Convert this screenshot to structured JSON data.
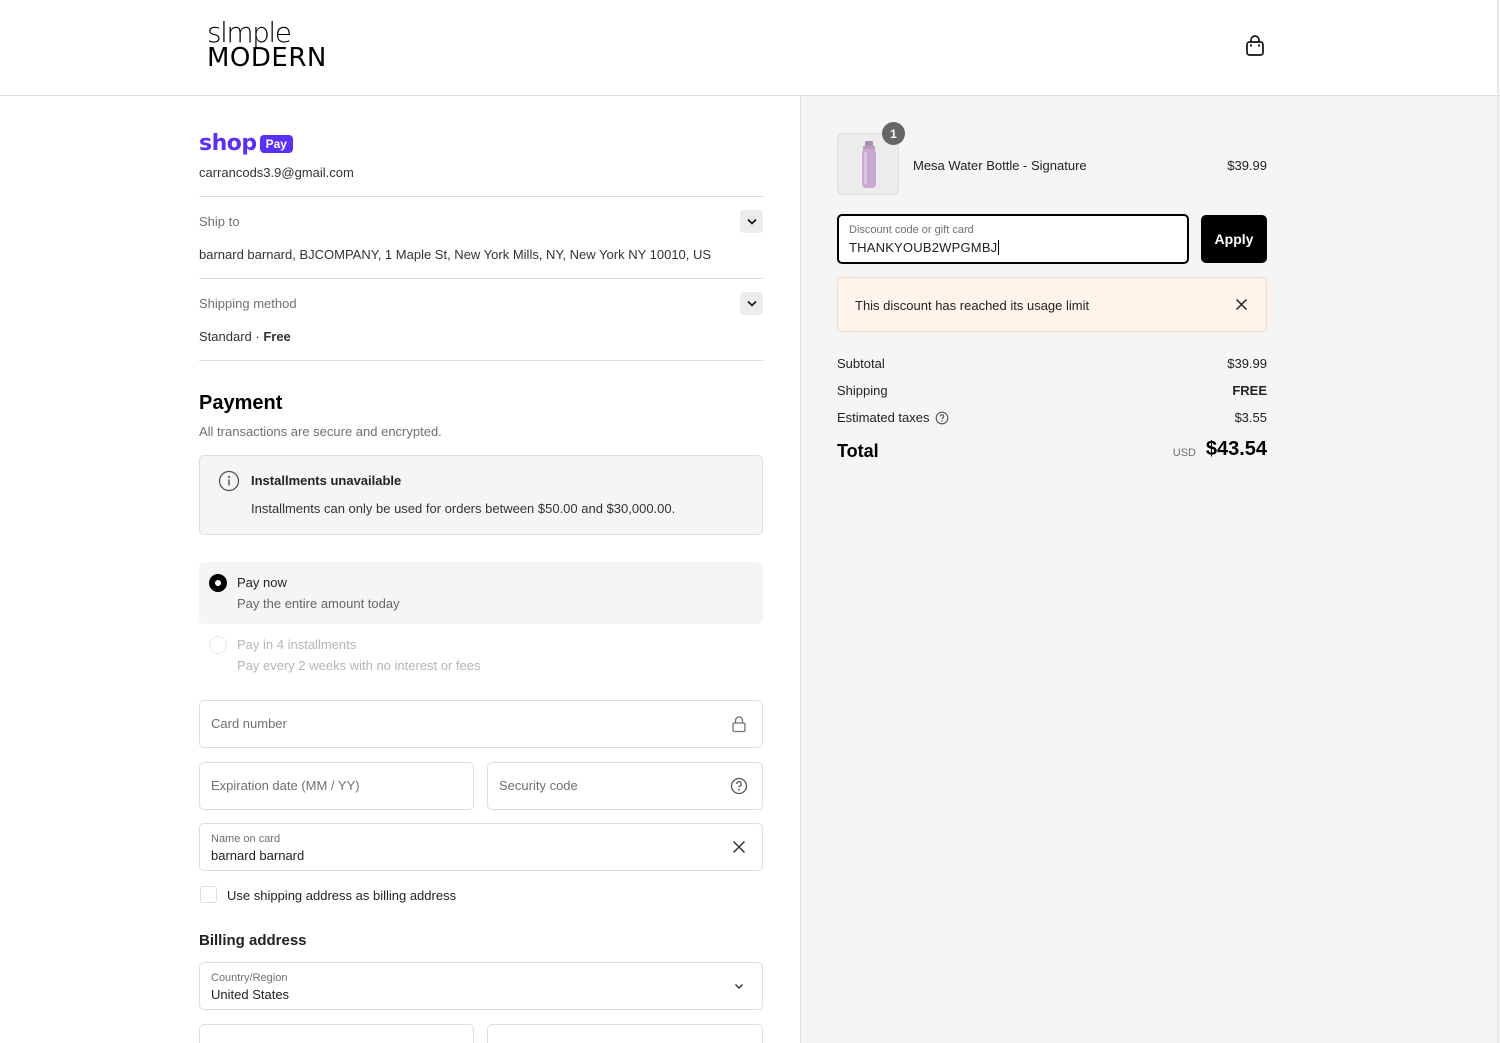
{
  "brand": {
    "line1": "slmple",
    "line2": "MODERN"
  },
  "header": {
    "cart_icon": "shopping-bag-icon"
  },
  "shop_pay": {
    "logo_text": "shop",
    "badge_text": "Pay",
    "email": "carrancods3.9@gmail.com"
  },
  "shipping": {
    "ship_to_label": "Ship to",
    "ship_to_value": "barnard barnard, BJCOMPANY, 1 Maple St, New York Mills, NY, New York NY 10010, US",
    "method_label": "Shipping method",
    "method_name": "Standard · ",
    "method_cost": "Free"
  },
  "payment": {
    "title": "Payment",
    "subtitle": "All transactions are secure and encrypted.",
    "notice_title": "Installments unavailable",
    "notice_body": "Installments can only be used for orders between $50.00 and $30,000.00.",
    "options": [
      {
        "title": "Pay now",
        "subtitle": "Pay the entire amount today",
        "selected": true,
        "disabled": false
      },
      {
        "title": "Pay in 4 installments",
        "subtitle": "Pay every 2 weeks with no interest or fees",
        "selected": false,
        "disabled": true
      }
    ],
    "card_number_placeholder": "Card number",
    "expiration_placeholder": "Expiration date (MM / YY)",
    "security_placeholder": "Security code",
    "name_label": "Name on card",
    "name_value": "barnard barnard",
    "billing_checkbox_label": "Use shipping address as billing address",
    "billing_checked": false
  },
  "billing": {
    "title": "Billing address",
    "country_label": "Country/Region",
    "country_value": "United States"
  },
  "order": {
    "item_name": "Mesa Water Bottle - Signature",
    "item_price": "$39.99",
    "quantity": "1",
    "discount_label": "Discount code or gift card",
    "discount_value": "THANKYOUB2WPGMBJ",
    "apply_label": "Apply",
    "alert_text": "This discount has reached its usage limit",
    "subtotal_label": "Subtotal",
    "subtotal_value": "$39.99",
    "shipping_label": "Shipping",
    "shipping_value": "FREE",
    "taxes_label": "Estimated taxes",
    "taxes_value": "$3.55",
    "total_label": "Total",
    "total_currency": "USD",
    "total_value": "$43.54"
  },
  "colors": {
    "shop_pay": "#5a31f4",
    "alert_bg": "#fff3ea",
    "sidebar_bg": "#f5f5f5",
    "product": "#c9a8d2"
  }
}
